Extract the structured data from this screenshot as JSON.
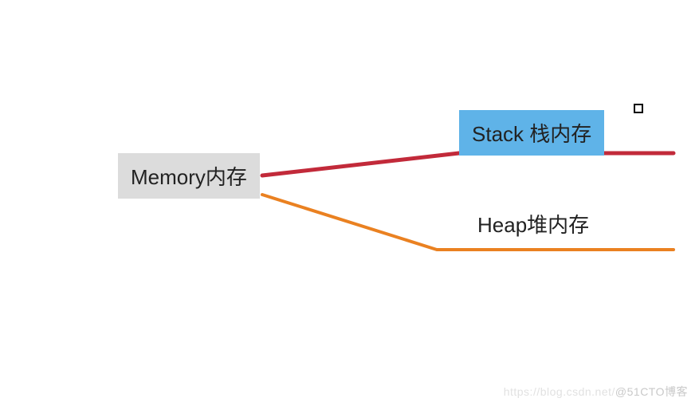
{
  "diagram": {
    "root": {
      "label": "Memory内存"
    },
    "nodes": {
      "stack": {
        "label": "Stack 栈内存",
        "selected": true
      },
      "heap": {
        "label": "Heap堆内存"
      }
    },
    "connectors": {
      "stack": {
        "color": "#c22a3a",
        "width": 5
      },
      "heap": {
        "color": "#ea8121",
        "width": 4
      }
    }
  },
  "watermark": {
    "left": "https://blog.csdn.net/",
    "right": "@51CTO博客"
  }
}
